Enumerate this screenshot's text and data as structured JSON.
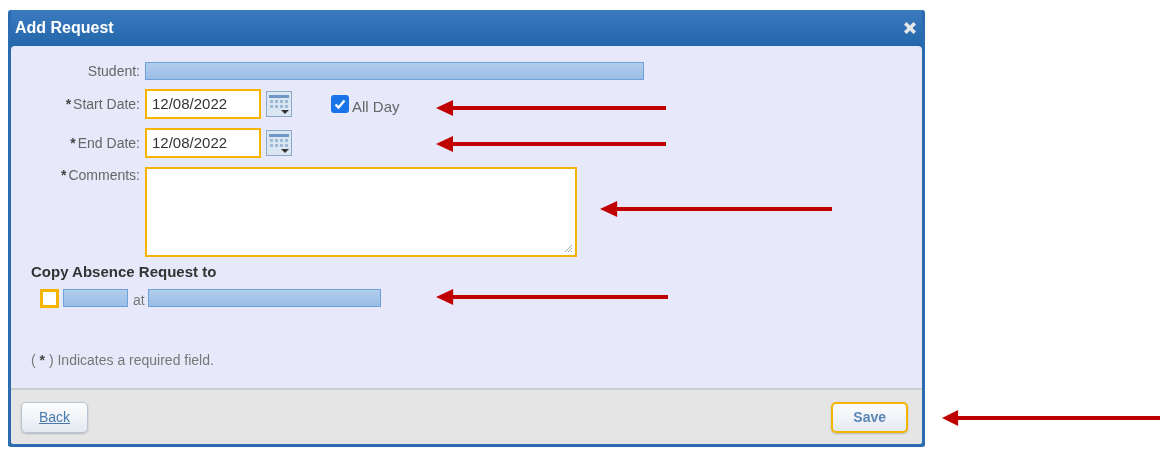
{
  "window": {
    "title": "Add Request"
  },
  "form": {
    "fields": [
      {
        "kind": "redacted",
        "label": "Student:"
      },
      {
        "kind": "date",
        "label": "Start Date:",
        "marker": "*",
        "value": "12/08/2022",
        "focused": true,
        "all_day": {
          "label": "All Day",
          "checked": true
        }
      },
      {
        "kind": "date",
        "label": "End Date:",
        "marker": "*",
        "value": "12/08/2022",
        "focused": true
      },
      {
        "kind": "textarea",
        "label": "Comments:",
        "marker": "*",
        "focused": true
      }
    ]
  },
  "copy_section": {
    "heading": "Copy Absence Request to",
    "checked": false,
    "joiner": "at"
  },
  "required_note": {
    "before": "(",
    "marker": "*",
    "after": ") Indicates a required field."
  },
  "buttons": [
    {
      "label": "Back",
      "kind": "link",
      "focused": false
    },
    {
      "label": "Save",
      "kind": "plain",
      "focused": true
    }
  ]
}
